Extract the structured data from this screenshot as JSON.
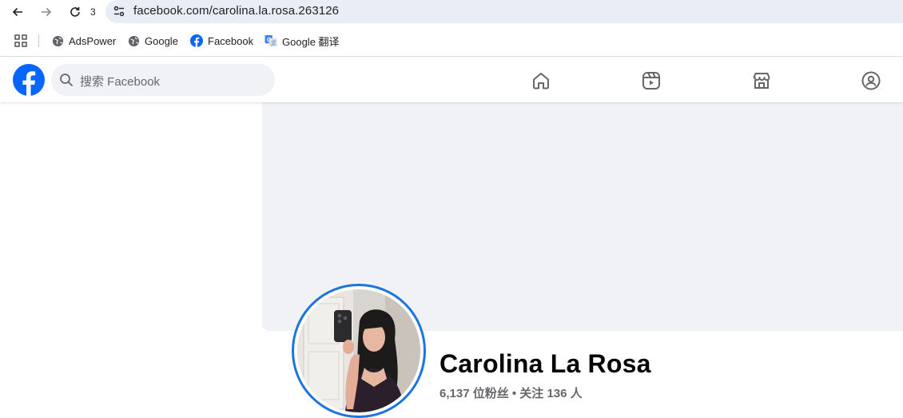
{
  "browser": {
    "reload_count": "3",
    "url": "facebook.com/carolina.la.rosa.263126",
    "bookmarks": [
      {
        "label": "AdsPower",
        "icon": "globe-icon"
      },
      {
        "label": "Google",
        "icon": "globe-icon"
      },
      {
        "label": "Facebook",
        "icon": "facebook-icon"
      },
      {
        "label": "Google 翻译",
        "icon": "google-translate-icon"
      }
    ]
  },
  "facebook": {
    "search_placeholder": "搜索 Facebook",
    "nav_icons": [
      "home-icon",
      "reels-icon",
      "marketplace-icon",
      "groups-icon"
    ],
    "brand_color": "#0866ff"
  },
  "profile": {
    "name": "Carolina La Rosa",
    "stats": "6,137 位粉丝 • 关注 136 人",
    "avatar_ring_color": "#1b74e4"
  }
}
